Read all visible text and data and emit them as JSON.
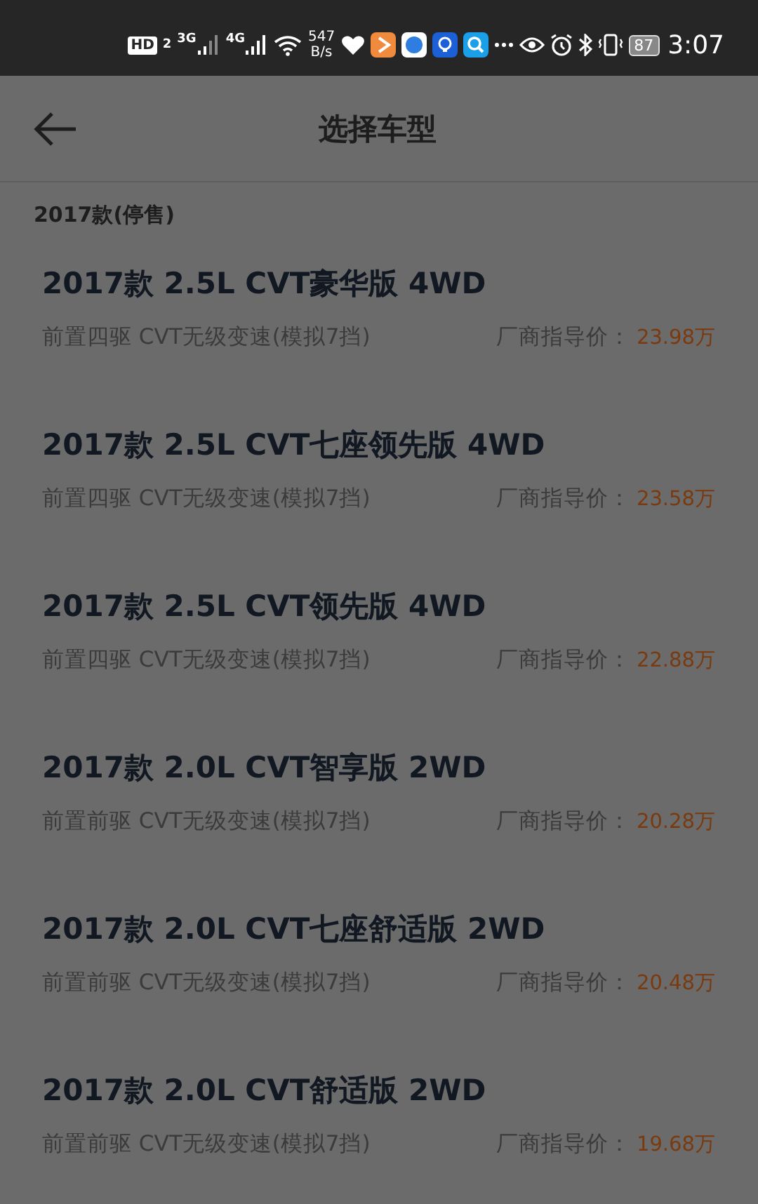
{
  "status_bar": {
    "hd": "HD",
    "sim": "2",
    "net1": "3G",
    "net2": "4G",
    "speed_value": "547",
    "speed_unit": "B/s",
    "battery": "87",
    "time": "3:07"
  },
  "header": {
    "title": "选择车型"
  },
  "section": {
    "title": "2017款(停售)"
  },
  "models": [
    {
      "name": "2017款 2.5L CVT豪华版 4WD",
      "spec": "前置四驱 CVT无级变速(模拟7挡)",
      "price_label": "厂商指导价：",
      "price": "23.98万"
    },
    {
      "name": "2017款 2.5L CVT七座领先版 4WD",
      "spec": "前置四驱 CVT无级变速(模拟7挡)",
      "price_label": "厂商指导价：",
      "price": "23.58万"
    },
    {
      "name": "2017款 2.5L CVT领先版 4WD",
      "spec": "前置四驱 CVT无级变速(模拟7挡)",
      "price_label": "厂商指导价：",
      "price": "22.88万"
    },
    {
      "name": "2017款 2.0L CVT智享版 2WD",
      "spec": "前置前驱 CVT无级变速(模拟7挡)",
      "price_label": "厂商指导价：",
      "price": "20.28万"
    },
    {
      "name": "2017款 2.0L CVT七座舒适版 2WD",
      "spec": "前置前驱 CVT无级变速(模拟7挡)",
      "price_label": "厂商指导价：",
      "price": "20.48万"
    },
    {
      "name": "2017款 2.0L CVT舒适版 2WD",
      "spec": "前置前驱 CVT无级变速(模拟7挡)",
      "price_label": "厂商指导价：",
      "price": "19.68万"
    }
  ]
}
